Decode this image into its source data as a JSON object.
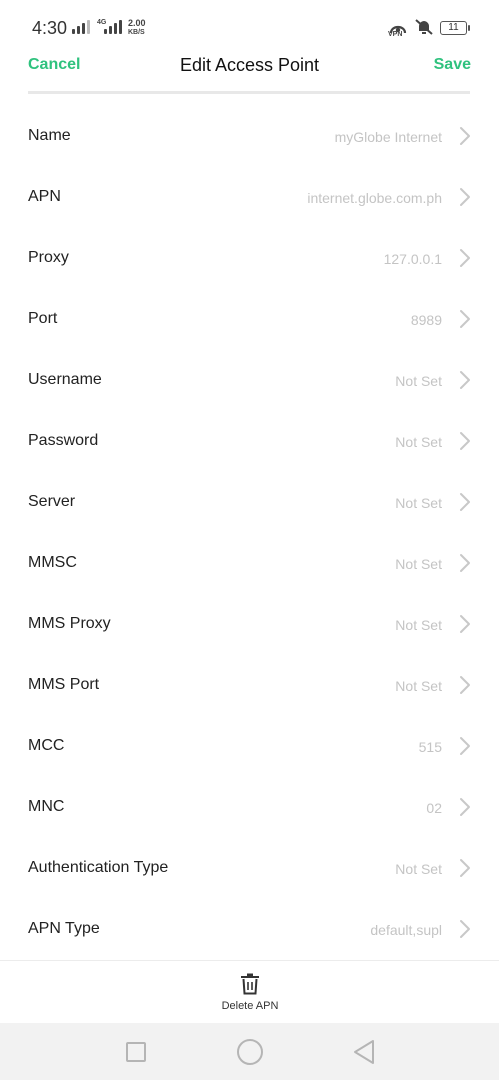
{
  "status_bar": {
    "time": "4:30",
    "network_tag": "4G",
    "speed_value": "2.00",
    "speed_unit": "KB/S",
    "vpn_label": "VPN",
    "battery": "11"
  },
  "header": {
    "cancel_label": "Cancel",
    "title": "Edit Access Point",
    "save_label": "Save",
    "accent_color": "#2fc27e"
  },
  "settings": [
    {
      "label": "Name",
      "value": "myGlobe Internet"
    },
    {
      "label": "APN",
      "value": "internet.globe.com.ph"
    },
    {
      "label": "Proxy",
      "value": "127.0.0.1"
    },
    {
      "label": "Port",
      "value": "8989"
    },
    {
      "label": "Username",
      "value": "Not Set"
    },
    {
      "label": "Password",
      "value": "Not Set"
    },
    {
      "label": "Server",
      "value": "Not Set"
    },
    {
      "label": "MMSC",
      "value": "Not Set"
    },
    {
      "label": "MMS Proxy",
      "value": "Not Set"
    },
    {
      "label": "MMS Port",
      "value": "Not Set"
    },
    {
      "label": "MCC",
      "value": "515"
    },
    {
      "label": "MNC",
      "value": "02"
    },
    {
      "label": "Authentication Type",
      "value": "Not Set"
    },
    {
      "label": "APN Type",
      "value": "default,supl"
    }
  ],
  "bottom_bar": {
    "delete_label": "Delete APN",
    "delete_icon": "trash-icon"
  },
  "nav_bar": {
    "icons": [
      "recents-square-icon",
      "home-circle-icon",
      "back-triangle-icon"
    ]
  }
}
